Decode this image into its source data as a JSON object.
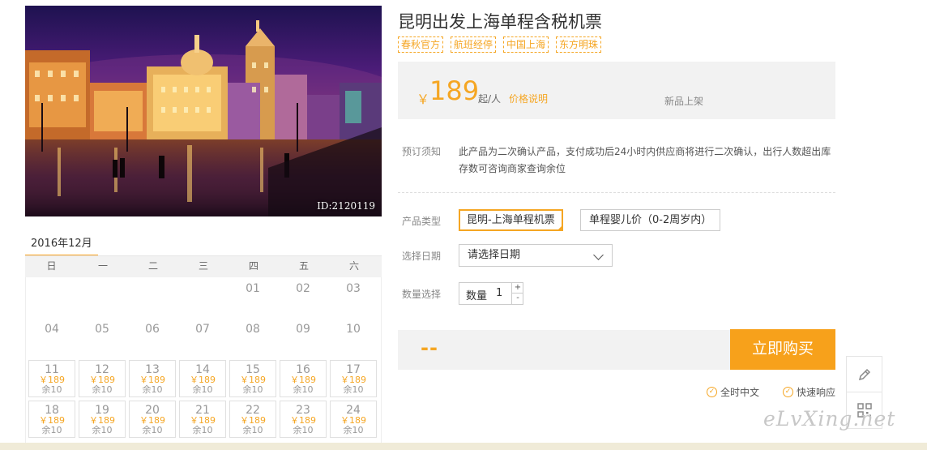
{
  "hero": {
    "id_label": "ID:2120119"
  },
  "calendar": {
    "month": "2016年12月",
    "weekdays": [
      "日",
      "一",
      "二",
      "三",
      "四",
      "五",
      "六"
    ],
    "rows": [
      [
        {
          "d": "",
          "p": "",
          "s": ""
        },
        {
          "d": "",
          "p": "",
          "s": ""
        },
        {
          "d": "",
          "p": "",
          "s": ""
        },
        {
          "d": "",
          "p": "",
          "s": ""
        },
        {
          "d": "01",
          "p": "",
          "s": ""
        },
        {
          "d": "02",
          "p": "",
          "s": ""
        },
        {
          "d": "03",
          "p": "",
          "s": ""
        }
      ],
      [
        {
          "d": "04",
          "p": "",
          "s": ""
        },
        {
          "d": "05",
          "p": "",
          "s": ""
        },
        {
          "d": "06",
          "p": "",
          "s": ""
        },
        {
          "d": "07",
          "p": "",
          "s": ""
        },
        {
          "d": "08",
          "p": "",
          "s": ""
        },
        {
          "d": "09",
          "p": "",
          "s": ""
        },
        {
          "d": "10",
          "p": "",
          "s": ""
        }
      ],
      [
        {
          "d": "11",
          "p": "￥189",
          "s": "余10"
        },
        {
          "d": "12",
          "p": "￥189",
          "s": "余10"
        },
        {
          "d": "13",
          "p": "￥189",
          "s": "余10"
        },
        {
          "d": "14",
          "p": "￥189",
          "s": "余10"
        },
        {
          "d": "15",
          "p": "￥189",
          "s": "余10"
        },
        {
          "d": "16",
          "p": "￥189",
          "s": "余10"
        },
        {
          "d": "17",
          "p": "￥189",
          "s": "余10"
        }
      ],
      [
        {
          "d": "18",
          "p": "￥189",
          "s": "余10"
        },
        {
          "d": "19",
          "p": "￥189",
          "s": "余10"
        },
        {
          "d": "20",
          "p": "￥189",
          "s": "余10"
        },
        {
          "d": "21",
          "p": "￥189",
          "s": "余10"
        },
        {
          "d": "22",
          "p": "￥189",
          "s": "余10"
        },
        {
          "d": "23",
          "p": "￥189",
          "s": "余10"
        },
        {
          "d": "24",
          "p": "￥189",
          "s": "余10"
        }
      ]
    ]
  },
  "product": {
    "title": "昆明出发上海单程含税机票",
    "tags": [
      "春秋官方",
      "航班经停",
      "中国上海",
      "东方明珠"
    ],
    "price": {
      "currency": "￥",
      "amount": "189",
      "unit": "起/人",
      "note_link": "价格说明",
      "new_label": "新品上架"
    }
  },
  "booking": {
    "notice_label": "预订须知",
    "notice_text": "此产品为二次确认产品，支付成功后24小时内供应商将进行二次确认，出行人数超出库存数可咨询商家查询余位",
    "type_label": "产品类型",
    "types": [
      "昆明-上海单程机票",
      "单程婴儿价（0-2周岁内）"
    ],
    "date_label": "选择日期",
    "date_placeholder": "请选择日期",
    "qty_label": "数量选择",
    "qty_prefix": "数量",
    "qty_value": "1",
    "qty_up": "+",
    "qty_down": "-",
    "total": "--",
    "buy_label": "立即购买",
    "services": [
      "全时中文",
      "快速响应"
    ]
  },
  "watermark": "eLvXing.net",
  "colors": {
    "accent": "#f5a623",
    "buy_button": "#f7a11b",
    "panel_bg": "#f2f2f2"
  },
  "icons": {
    "float_tool_1": "pencil-icon",
    "float_tool_2": "qr-code-icon",
    "service_check": "check-circle-icon"
  }
}
